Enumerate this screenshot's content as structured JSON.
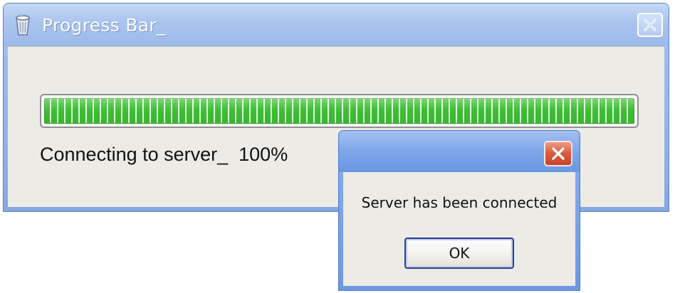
{
  "main_window": {
    "title": "Progress Bar_",
    "status_text": "Connecting to server_  100%",
    "progress_percent": 100
  },
  "message_dialog": {
    "message": "Server has been connected",
    "ok_label": "OK"
  },
  "icons": {
    "app": "recycle-bin-icon",
    "main_close": "close-icon",
    "dialog_close": "close-icon"
  },
  "colors": {
    "progress_fill": "#3cc032",
    "titlebar": "#9cb9ea",
    "dialog_close": "#db5a3c",
    "client_background": "#ecebe6"
  }
}
